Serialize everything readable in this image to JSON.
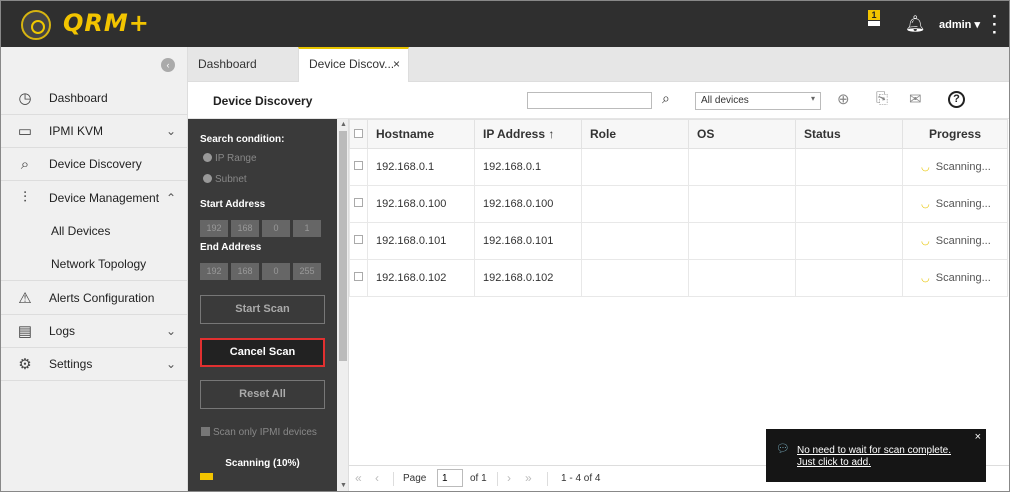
{
  "brand": {
    "name": "QRM+"
  },
  "header": {
    "notification_count": "1",
    "user": "admin",
    "user_caret": "▾",
    "menu_icon": "kebab-icon"
  },
  "sidebar": {
    "collapse_icon": "‹",
    "items": [
      {
        "label": "Dashboard",
        "icon": "dashboard-icon",
        "glyph": "◷"
      },
      {
        "label": "IPMI KVM",
        "icon": "monitor-icon",
        "glyph": "▭",
        "chevron": "⌄"
      },
      {
        "label": "Device Discovery",
        "icon": "discovery-icon",
        "glyph": "⌕"
      },
      {
        "label": "Device Management",
        "icon": "sliders-icon",
        "glyph": "⫶",
        "chevron": "⌃"
      },
      {
        "label": "All Devices"
      },
      {
        "label": "Network Topology"
      },
      {
        "label": "Alerts Configuration",
        "icon": "alert-icon",
        "glyph": "⚠"
      },
      {
        "label": "Logs",
        "icon": "logs-icon",
        "glyph": "▤",
        "chevron": "⌄"
      },
      {
        "label": "Settings",
        "icon": "gear-icon",
        "glyph": "⚙",
        "chevron": "⌄"
      }
    ]
  },
  "tabs": [
    {
      "label": "Dashboard"
    },
    {
      "label": "Device Discov...",
      "close": "×"
    }
  ],
  "toolbar": {
    "title": "Device Discovery",
    "search_value": "",
    "filter_value": "All devices",
    "filter_caret": "▾"
  },
  "panel": {
    "search_condition_label": "Search condition:",
    "option_ip_range": "IP Range",
    "option_subnet": "Subnet",
    "start_label": "Start Address",
    "start_octets": [
      "192",
      "168",
      "0",
      "1"
    ],
    "end_label": "End Address",
    "end_octets": [
      "192",
      "168",
      "0",
      "255"
    ],
    "start_scan": "Start Scan",
    "cancel_scan": "Cancel Scan",
    "reset_all": "Reset All",
    "ipmi_only": "Scan only IPMI devices",
    "scan_status": "Scanning (10%)",
    "scan_progress": 0.1
  },
  "table": {
    "columns": [
      "Hostname",
      "IP Address ↑",
      "Role",
      "OS",
      "Status",
      "Progress"
    ],
    "rows": [
      {
        "hostname": "192.168.0.1",
        "ip": "192.168.0.1",
        "role": "",
        "os": "",
        "status": "",
        "progress": "Scanning..."
      },
      {
        "hostname": "192.168.0.100",
        "ip": "192.168.0.100",
        "role": "",
        "os": "",
        "status": "",
        "progress": "Scanning..."
      },
      {
        "hostname": "192.168.0.101",
        "ip": "192.168.0.101",
        "role": "",
        "os": "",
        "status": "",
        "progress": "Scanning..."
      },
      {
        "hostname": "192.168.0.102",
        "ip": "192.168.0.102",
        "role": "",
        "os": "",
        "status": "",
        "progress": "Scanning..."
      }
    ]
  },
  "pager": {
    "page_label": "Page",
    "page_value": "1",
    "of_label": "of 1",
    "range": "1 - 4 of 4"
  },
  "toast": {
    "message": "No need to wait for scan complete. Just click to add.",
    "close": "×"
  },
  "colors": {
    "accent": "#f2c400",
    "cancel_border": "#e13030",
    "topbar": "#2f2f2f",
    "panel": "#3a3a3a"
  }
}
